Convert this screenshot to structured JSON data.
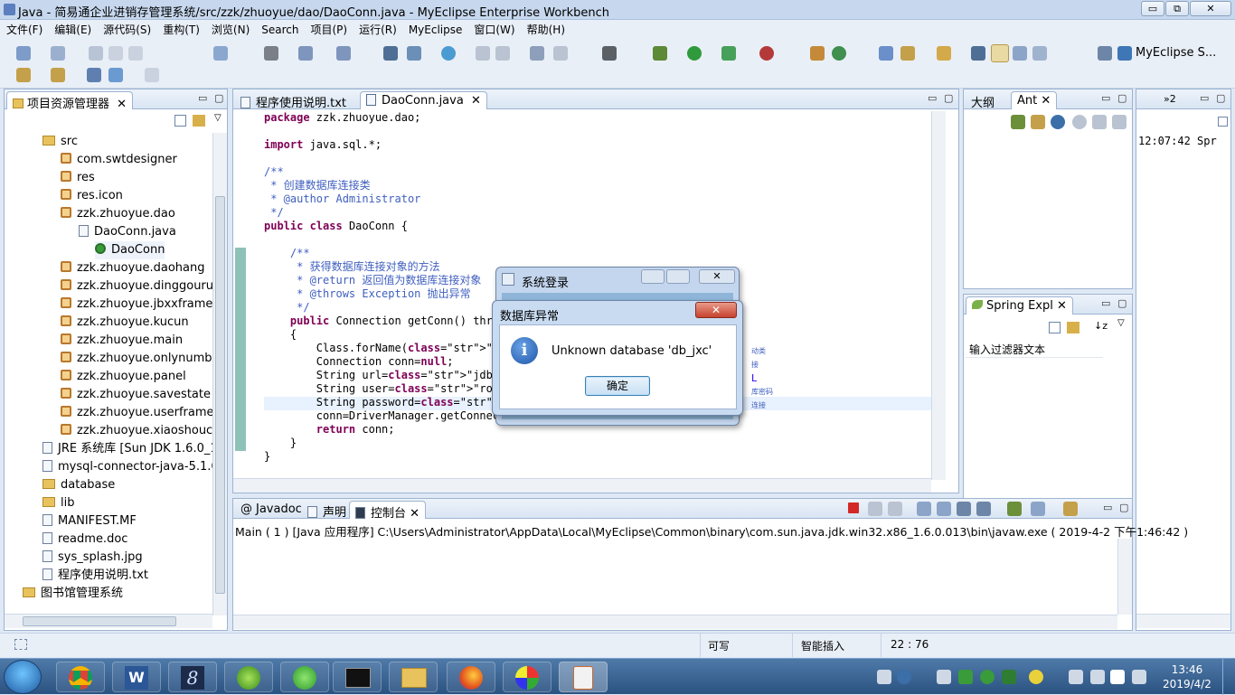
{
  "window": {
    "title": "Java  -  简易通企业进销存管理系统/src/zzk/zhuoyue/dao/DaoConn.java  -  MyEclipse Enterprise Workbench",
    "min": "▭",
    "max": "⧉",
    "close": "✕"
  },
  "menu": [
    "文件(F)",
    "编辑(E)",
    "源代码(S)",
    "重构(T)",
    "浏览(N)",
    "Search",
    "项目(P)",
    "运行(R)",
    "MyEclipse",
    "窗口(W)",
    "帮助(H)"
  ],
  "perspective": {
    "label": "MyEclipse S..."
  },
  "explorer": {
    "tab": "项目资源管理器",
    "items": [
      {
        "label": "src",
        "icon": "folder"
      },
      {
        "label": "com.swtdesigner",
        "icon": "package"
      },
      {
        "label": "res",
        "icon": "package"
      },
      {
        "label": "res.icon",
        "icon": "package"
      },
      {
        "label": "zzk.zhuoyue.dao",
        "icon": "package"
      },
      {
        "label": "DaoConn.java",
        "icon": "java-file"
      },
      {
        "label": "DaoConn",
        "icon": "class"
      },
      {
        "label": "zzk.zhuoyue.daohang",
        "icon": "package"
      },
      {
        "label": "zzk.zhuoyue.dinggouruku",
        "icon": "package"
      },
      {
        "label": "zzk.zhuoyue.jbxxframe",
        "icon": "package"
      },
      {
        "label": "zzk.zhuoyue.kucun",
        "icon": "package"
      },
      {
        "label": "zzk.zhuoyue.main",
        "icon": "package"
      },
      {
        "label": "zzk.zhuoyue.onlynumber",
        "icon": "package"
      },
      {
        "label": "zzk.zhuoyue.panel",
        "icon": "package"
      },
      {
        "label": "zzk.zhuoyue.savestate",
        "icon": "package"
      },
      {
        "label": "zzk.zhuoyue.userframe",
        "icon": "package"
      },
      {
        "label": "zzk.zhuoyue.xiaoshouchu",
        "icon": "package"
      },
      {
        "label": "JRE 系统库 [Sun JDK 1.6.0_13",
        "icon": "library"
      },
      {
        "label": "mysql-connector-java-5.1.6-b",
        "icon": "jar"
      },
      {
        "label": "database",
        "icon": "folder"
      },
      {
        "label": "lib",
        "icon": "folder"
      },
      {
        "label": "MANIFEST.MF",
        "icon": "file"
      },
      {
        "label": "readme.doc",
        "icon": "file"
      },
      {
        "label": "sys_splash.jpg",
        "icon": "file"
      },
      {
        "label": "程序使用说明.txt",
        "icon": "file"
      },
      {
        "label": "图书馆管理系统",
        "icon": "project"
      }
    ]
  },
  "editor": {
    "tabs": [
      "程序使用说明.txt",
      "DaoConn.java"
    ],
    "code": [
      {
        "t": "package zzk.zhuoyue.dao;",
        "c": "plain"
      },
      {
        "t": "",
        "c": "plain"
      },
      {
        "t": "import java.sql.*;",
        "c": "plain"
      },
      {
        "t": "",
        "c": "plain"
      },
      {
        "t": "/**",
        "c": "cm"
      },
      {
        "t": " * 创建数据库连接类",
        "c": "cm"
      },
      {
        "t": " * @author Administrator",
        "c": "cm"
      },
      {
        "t": " */",
        "c": "cm"
      },
      {
        "t": "public class DaoConn {",
        "c": "plain"
      },
      {
        "t": "",
        "c": "plain"
      },
      {
        "t": "    /**",
        "c": "cm"
      },
      {
        "t": "     * 获得数据库连接对象的方法",
        "c": "cm"
      },
      {
        "t": "     * @return 返回值为数据库连接对象",
        "c": "cm"
      },
      {
        "t": "     * @throws Exception 抛出异常",
        "c": "cm"
      },
      {
        "t": "     */",
        "c": "cm"
      },
      {
        "t": "    public Connection getConn() thro",
        "c": "plain"
      },
      {
        "t": "    {",
        "c": "plain"
      },
      {
        "t": "        Class.forName(\"com.mysql.jdb",
        "c": "plain"
      },
      {
        "t": "        Connection conn=null;",
        "c": "plain"
      },
      {
        "t": "        String url=\"jdbc:mysql://loc",
        "c": "plain"
      },
      {
        "t": "        String user=\"root\";",
        "c": "plain"
      },
      {
        "t": "        String password=\"19881130\";",
        "c": "plain"
      },
      {
        "t": "        conn=DriverManager.getConnect",
        "c": "plain"
      },
      {
        "t": "        return conn;",
        "c": "plain"
      },
      {
        "t": "    }",
        "c": "plain"
      },
      {
        "t": "}",
        "c": "plain"
      }
    ],
    "right_fragments": [
      "动类",
      "接",
      "L",
      "",
      "库密码",
      "连接"
    ]
  },
  "outline": {
    "tabs": [
      "大纲",
      "Ant"
    ]
  },
  "spring": {
    "tab": "Spring Expl",
    "filter": "输入过滤器文本"
  },
  "extra": {
    "tab": "»2",
    "log": "12:07:42 Spr"
  },
  "console": {
    "tabs": [
      "Javadoc",
      "声明",
      "控制台"
    ],
    "line": "Main ( 1 )  [Java 应用程序] C:\\Users\\Administrator\\AppData\\Local\\MyEclipse\\Common\\binary\\com.sun.java.jdk.win32.x86_1.6.0.013\\bin\\javaw.exe ( 2019-4-2 下午1:46:42 )"
  },
  "status": {
    "writable": "可写",
    "insert": "智能插入",
    "position": "22 : 76"
  },
  "login_dialog": {
    "title": "系统登录"
  },
  "error_dialog": {
    "title": "数据库异常",
    "message": "Unknown database 'db_jxc'",
    "ok": "确定",
    "close": "✕"
  },
  "taskbar": {
    "time": "13:46",
    "date": "2019/4/2",
    "apps": [
      "chrome",
      "word",
      "eclipse-8",
      "leaf-app",
      "ie-refresh",
      "cmd",
      "explorer",
      "firefox",
      "paint",
      "java"
    ]
  },
  "colors": {
    "keyword": "#7f0055",
    "string": "#2a00ff",
    "comment": "#3f5fbf",
    "taskbar": "#2b5382"
  }
}
